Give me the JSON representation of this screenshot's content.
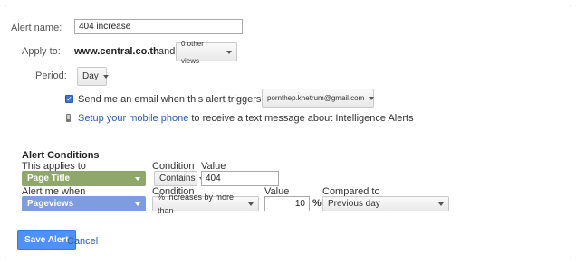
{
  "form": {
    "alert_name_label": "Alert name:",
    "alert_name_value": "404 increase",
    "apply_to_label": "Apply to:",
    "site": "www.central.co.th",
    "and_text": "and",
    "views_dropdown": "0 other views",
    "period_label": "Period:",
    "period_value": "Day",
    "email_checkbox_checked": true,
    "email_text": "Send me an email when this alert triggers. Also include",
    "email_dropdown": "pornthep.khetrum@gmail.com",
    "mobile_link": "Setup your mobile phone",
    "mobile_text": "to receive a text message about Intelligence Alerts"
  },
  "conditions": {
    "heading": "Alert Conditions",
    "applies_to_label": "This applies to",
    "condition_label": "Condition",
    "value_label": "Value",
    "applies_to_value": "Page Title",
    "condition_value": "Contains",
    "value_value": "404",
    "alert_when_label": "Alert me when",
    "condition_label_2": "Condition",
    "value_label_2": "Value",
    "compared_label": "Compared to",
    "metric_value": "Pageviews",
    "metric_condition": "% increases by more than",
    "metric_value_input": "10",
    "percent_sign": "%",
    "compared_value": "Previous day"
  },
  "actions": {
    "save": "Save Alert",
    "cancel": "Cancel"
  },
  "colors": {
    "applies_to_bg": "#8fa86a",
    "metric_bg": "#7d9de0",
    "primary_button": "#4d90fe",
    "link": "#2a5db0"
  }
}
